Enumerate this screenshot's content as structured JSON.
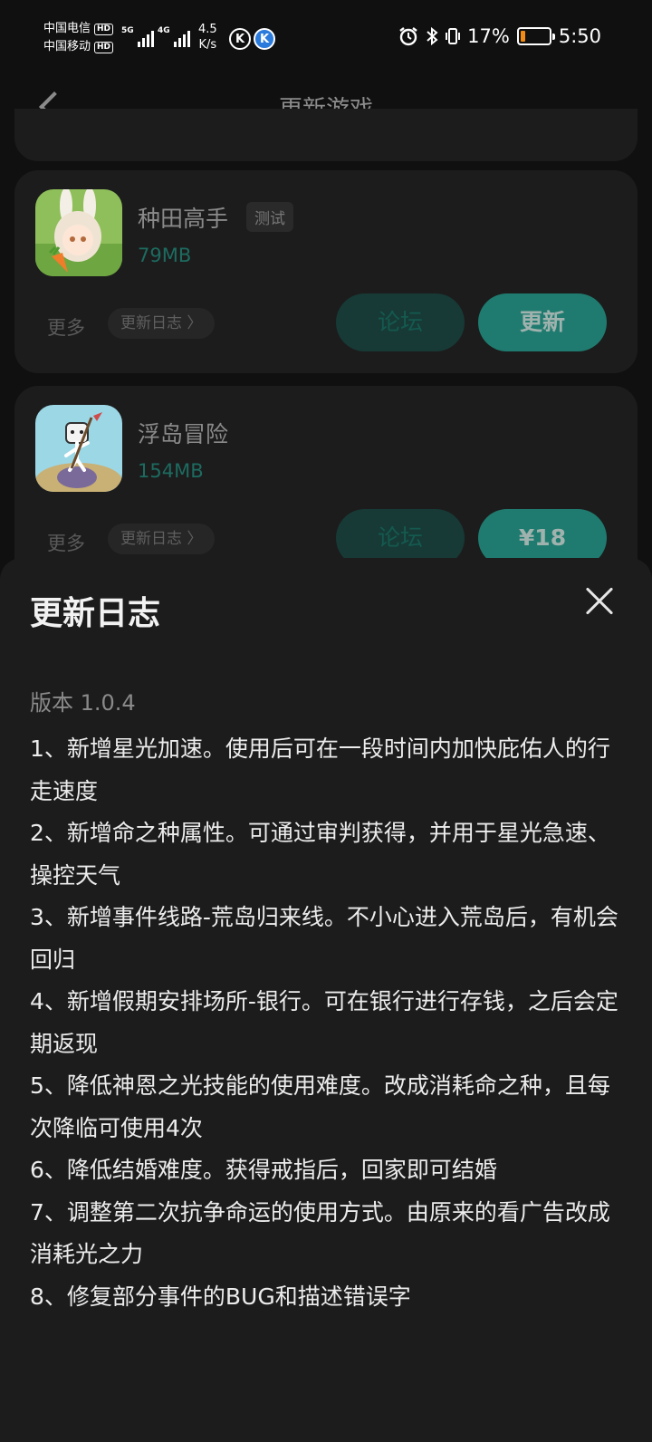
{
  "status_bar": {
    "carrier1": "中国电信",
    "carrier2": "中国移动",
    "hd": "HD",
    "sim1_network": "5G",
    "sim2_network": "4G",
    "net_speed_value": "4.5",
    "net_speed_unit": "K/s",
    "k_icon": "K",
    "battery_percent": "17%",
    "battery_level": 0.17,
    "time": "5:50"
  },
  "header": {
    "title": "更新游戏"
  },
  "games": [
    {
      "name": "种田高手",
      "tag": "测试",
      "size": "79MB",
      "more": "更多",
      "log_label": "更新日志 〉",
      "forum": "论坛",
      "action": "更新"
    },
    {
      "name": "浮岛冒险",
      "size": "154MB",
      "more": "更多",
      "log_label": "更新日志 〉",
      "forum": "论坛",
      "action": "¥18"
    }
  ],
  "sheet": {
    "title": "更新日志",
    "version": "版本 1.0.4",
    "changes": [
      "1、新增星光加速。使用后可在一段时间内加快庇佑人的行走速度",
      "2、新增命之种属性。可通过审判获得，并用于星光急速、操控天气",
      "3、新增事件线路-荒岛归来线。不小心进入荒岛后，有机会回归",
      "4、新增假期安排场所-银行。可在银行进行存钱，之后会定期返现",
      "5、降低神恩之光技能的使用难度。改成消耗命之种，且每次降临可使用4次",
      "6、降低结婚难度。获得戒指后，回家即可结婚",
      "7、调整第二次抗争命运的使用方式。由原来的看广告改成消耗光之力",
      "8、修复部分事件的BUG和描述错误字"
    ]
  }
}
